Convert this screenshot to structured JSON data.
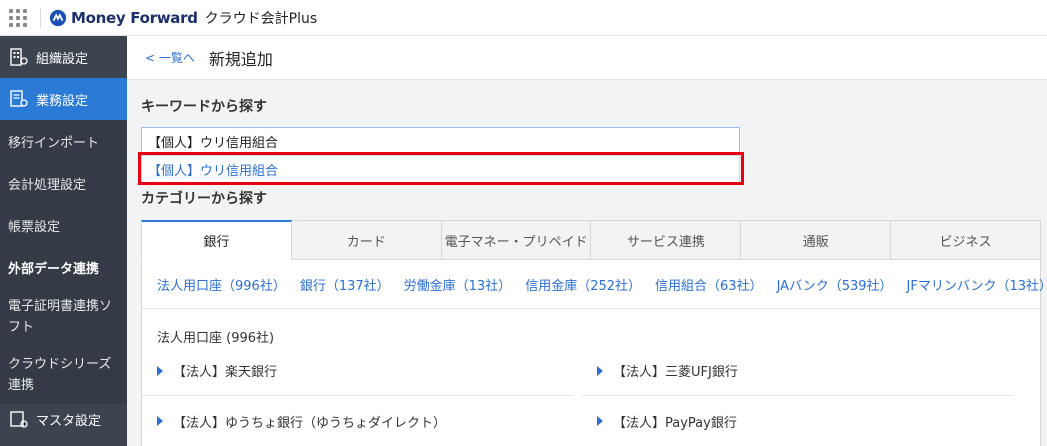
{
  "header": {
    "brand": "Money Forward",
    "product": "クラウド会計Plus"
  },
  "sidebar": {
    "items": [
      {
        "label": "組織設定",
        "icon": "building-icon"
      },
      {
        "label": "業務設定",
        "icon": "settings-doc-icon"
      },
      {
        "label": "移行インポート"
      },
      {
        "label": "会計処理設定"
      },
      {
        "label": "帳票設定"
      },
      {
        "label": "外部データ連携"
      },
      {
        "label": "電子証明書連携ソフト"
      },
      {
        "label": "クラウドシリーズ連携"
      },
      {
        "label": "マスタ設定",
        "icon": "master-icon"
      }
    ]
  },
  "breadcrumb": {
    "back": "< 一覧へ",
    "title": "新規追加"
  },
  "keyword": {
    "title": "キーワードから探す",
    "value": "【個人】ウリ信用組合",
    "suggestion": "【個人】ウリ信用組合"
  },
  "category": {
    "title": "カテゴリーから探す",
    "tabs": [
      "銀行",
      "カード",
      "電子マネー・プリペイド",
      "サービス連携",
      "通販",
      "ビジネス"
    ],
    "subcategories": [
      "法人用口座（996社）",
      "銀行（137社）",
      "労働金庫（13社）",
      "信用金庫（252社）",
      "信用組合（63社）",
      "JAバンク（539社）",
      "JFマリンバンク（13社）"
    ],
    "group_title": "法人用口座 (996社)",
    "banks": [
      "【法人】楽天銀行",
      "【法人】三菱UFJ銀行",
      "【法人】ゆうちょ銀行（ゆうちょダイレクト）",
      "【法人】PayPay銀行"
    ]
  },
  "colors": {
    "accent": "#2b7bd6",
    "link": "#2b6fd6",
    "sidebar": "#3c4450",
    "highlight": "#e60012"
  }
}
